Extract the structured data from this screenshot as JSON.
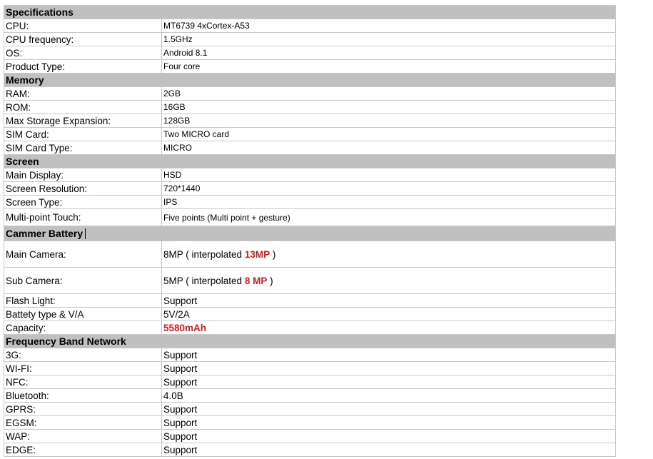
{
  "sections": {
    "specifications": {
      "title": "Specifications",
      "rows": [
        {
          "label": "CPU:",
          "value": "MT6739  4xCortex-A53"
        },
        {
          "label": "CPU frequency:",
          "value": "1.5GHz"
        },
        {
          "label": "OS:",
          "value": "Android 8.1"
        },
        {
          "label": "Product Type:",
          "value": "Four core"
        }
      ]
    },
    "memory": {
      "title": "Memory",
      "rows": [
        {
          "label": "RAM:",
          "value": "2GB"
        },
        {
          "label": "ROM:",
          "value": "16GB"
        },
        {
          "label": "Max Storage Expansion:",
          "value": "128GB"
        },
        {
          "label": "SIM Card:",
          "value": "Two MICRO card"
        },
        {
          "label": "SIM Card Type:",
          "value": "MICRO"
        }
      ]
    },
    "screen": {
      "title": "Screen",
      "rows": [
        {
          "label": "Main Display:",
          "value": "HSD"
        },
        {
          "label": "Screen Resolution:",
          "value": "720*1440"
        },
        {
          "label": "Screen Type:",
          "value": "IPS"
        },
        {
          "label": "Multi-point Touch:",
          "value": "Five points (Multi point + gesture)"
        }
      ]
    },
    "camera_battery": {
      "title": "Cammer Battery",
      "rows": [
        {
          "label": "Main Camera:",
          "value_pre": "8MP ( interpolated ",
          "value_hl": "13MP",
          "value_post": " )"
        },
        {
          "label": "Sub Camera:",
          "value_pre": "5MP ( interpolated ",
          "value_hl": "8 MP",
          "value_post": " )"
        },
        {
          "label": "Flash Light:",
          "value": "Support"
        },
        {
          "label": "Battety type & V/A",
          "value": "5V/2A"
        },
        {
          "label": "Capacity:",
          "value_hl": "5580mAh"
        }
      ]
    },
    "network": {
      "title": "Frequency Band Network",
      "rows": [
        {
          "label": "3G:",
          "value": "Support"
        },
        {
          "label": "WI-FI:",
          "value": "Support"
        },
        {
          "label": "NFC:",
          "value": "Support"
        },
        {
          "label": "Bluetooth:",
          "value": "4.0B"
        },
        {
          "label": "GPRS:",
          "value": "Support"
        },
        {
          "label": "EGSM:",
          "value": "Support"
        },
        {
          "label": "WAP:",
          "value": "Support"
        },
        {
          "label": "EDGE:",
          "value": "Support"
        }
      ]
    }
  },
  "colors": {
    "section_bg": "#c0c0c0",
    "highlight": "#d81b1b",
    "border": "#c8c8c8"
  }
}
